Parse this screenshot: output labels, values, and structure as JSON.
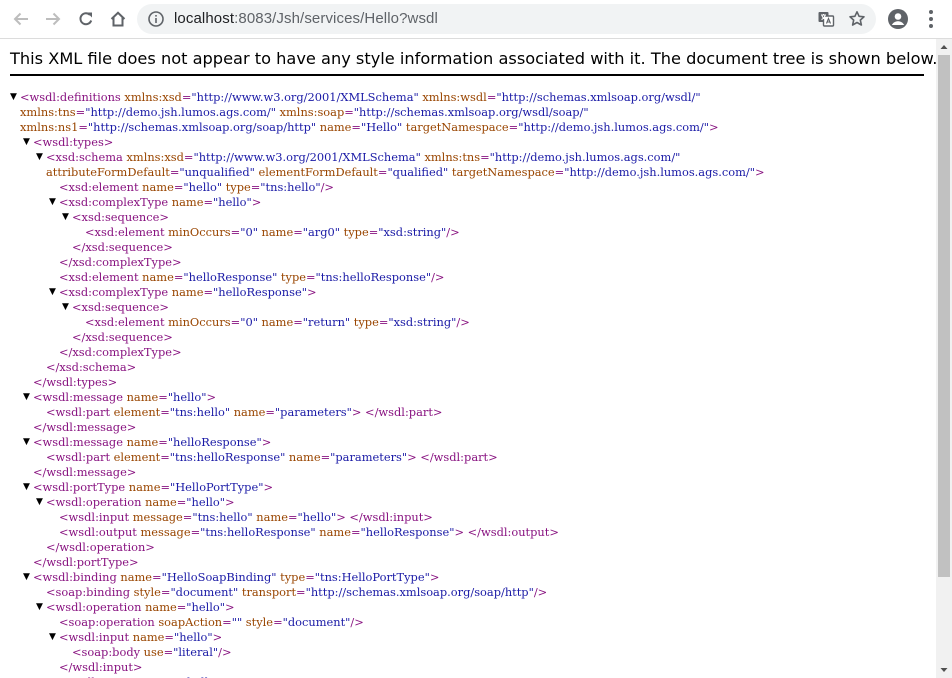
{
  "browser": {
    "url_host": "localhost",
    "url_rest": ":8083/Jsh/services/Hello?wsdl"
  },
  "page": {
    "info_message": "This XML file does not appear to have any style information associated with it. The document tree is shown below."
  },
  "colors": {
    "tag": "#881280",
    "attr_name": "#994500",
    "attr_value": "#1a1aa6"
  },
  "xml_lines": [
    {
      "indent": 0,
      "toggle": true,
      "parts": [
        [
          "t",
          "<wsdl:definitions"
        ],
        [
          "n",
          " xmlns:xsd"
        ],
        [
          "t",
          "="
        ],
        [
          "v",
          "\"http://www.w3.org/2001/XMLSchema\""
        ],
        [
          "n",
          " xmlns:wsdl"
        ],
        [
          "t",
          "="
        ],
        [
          "v",
          "\"http://schemas.xmlsoap.org/wsdl/\""
        ]
      ]
    },
    {
      "indent": 0,
      "toggle": false,
      "parts": [
        [
          "n",
          "xmlns:tns"
        ],
        [
          "t",
          "="
        ],
        [
          "v",
          "\"http://demo.jsh.lumos.ags.com/\""
        ],
        [
          "n",
          " xmlns:soap"
        ],
        [
          "t",
          "="
        ],
        [
          "v",
          "\"http://schemas.xmlsoap.org/wsdl/soap/\""
        ]
      ]
    },
    {
      "indent": 0,
      "toggle": false,
      "parts": [
        [
          "n",
          "xmlns:ns1"
        ],
        [
          "t",
          "="
        ],
        [
          "v",
          "\"http://schemas.xmlsoap.org/soap/http\""
        ],
        [
          "n",
          " name"
        ],
        [
          "t",
          "="
        ],
        [
          "v",
          "\"Hello\""
        ],
        [
          "n",
          " targetNamespace"
        ],
        [
          "t",
          "="
        ],
        [
          "v",
          "\"http://demo.jsh.lumos.ags.com/\""
        ],
        [
          "t",
          ">"
        ]
      ]
    },
    {
      "indent": 1,
      "toggle": true,
      "parts": [
        [
          "t",
          "<wsdl:types>"
        ]
      ]
    },
    {
      "indent": 2,
      "toggle": true,
      "parts": [
        [
          "t",
          "<xsd:schema"
        ],
        [
          "n",
          " xmlns:xsd"
        ],
        [
          "t",
          "="
        ],
        [
          "v",
          "\"http://www.w3.org/2001/XMLSchema\""
        ],
        [
          "n",
          " xmlns:tns"
        ],
        [
          "t",
          "="
        ],
        [
          "v",
          "\"http://demo.jsh.lumos.ags.com/\""
        ]
      ]
    },
    {
      "indent": 2,
      "toggle": false,
      "parts": [
        [
          "n",
          "attributeFormDefault"
        ],
        [
          "t",
          "="
        ],
        [
          "v",
          "\"unqualified\""
        ],
        [
          "n",
          " elementFormDefault"
        ],
        [
          "t",
          "="
        ],
        [
          "v",
          "\"qualified\""
        ],
        [
          "n",
          " targetNamespace"
        ],
        [
          "t",
          "="
        ],
        [
          "v",
          "\"http://demo.jsh.lumos.ags.com/\""
        ],
        [
          "t",
          ">"
        ]
      ]
    },
    {
      "indent": 3,
      "toggle": false,
      "parts": [
        [
          "t",
          "<xsd:element"
        ],
        [
          "n",
          " name"
        ],
        [
          "t",
          "="
        ],
        [
          "v",
          "\"hello\""
        ],
        [
          "n",
          " type"
        ],
        [
          "t",
          "="
        ],
        [
          "v",
          "\"tns:hello\""
        ],
        [
          "t",
          "/>"
        ]
      ]
    },
    {
      "indent": 3,
      "toggle": true,
      "parts": [
        [
          "t",
          "<xsd:complexType"
        ],
        [
          "n",
          " name"
        ],
        [
          "t",
          "="
        ],
        [
          "v",
          "\"hello\""
        ],
        [
          "t",
          ">"
        ]
      ]
    },
    {
      "indent": 4,
      "toggle": true,
      "parts": [
        [
          "t",
          "<xsd:sequence>"
        ]
      ]
    },
    {
      "indent": 5,
      "toggle": false,
      "parts": [
        [
          "t",
          "<xsd:element"
        ],
        [
          "n",
          " minOccurs"
        ],
        [
          "t",
          "="
        ],
        [
          "v",
          "\"0\""
        ],
        [
          "n",
          " name"
        ],
        [
          "t",
          "="
        ],
        [
          "v",
          "\"arg0\""
        ],
        [
          "n",
          " type"
        ],
        [
          "t",
          "="
        ],
        [
          "v",
          "\"xsd:string\""
        ],
        [
          "t",
          "/>"
        ]
      ]
    },
    {
      "indent": 4,
      "toggle": false,
      "parts": [
        [
          "t",
          "</xsd:sequence>"
        ]
      ]
    },
    {
      "indent": 3,
      "toggle": false,
      "parts": [
        [
          "t",
          "</xsd:complexType>"
        ]
      ]
    },
    {
      "indent": 3,
      "toggle": false,
      "parts": [
        [
          "t",
          "<xsd:element"
        ],
        [
          "n",
          " name"
        ],
        [
          "t",
          "="
        ],
        [
          "v",
          "\"helloResponse\""
        ],
        [
          "n",
          " type"
        ],
        [
          "t",
          "="
        ],
        [
          "v",
          "\"tns:helloResponse\""
        ],
        [
          "t",
          "/>"
        ]
      ]
    },
    {
      "indent": 3,
      "toggle": true,
      "parts": [
        [
          "t",
          "<xsd:complexType"
        ],
        [
          "n",
          " name"
        ],
        [
          "t",
          "="
        ],
        [
          "v",
          "\"helloResponse\""
        ],
        [
          "t",
          ">"
        ]
      ]
    },
    {
      "indent": 4,
      "toggle": true,
      "parts": [
        [
          "t",
          "<xsd:sequence>"
        ]
      ]
    },
    {
      "indent": 5,
      "toggle": false,
      "parts": [
        [
          "t",
          "<xsd:element"
        ],
        [
          "n",
          " minOccurs"
        ],
        [
          "t",
          "="
        ],
        [
          "v",
          "\"0\""
        ],
        [
          "n",
          " name"
        ],
        [
          "t",
          "="
        ],
        [
          "v",
          "\"return\""
        ],
        [
          "n",
          " type"
        ],
        [
          "t",
          "="
        ],
        [
          "v",
          "\"xsd:string\""
        ],
        [
          "t",
          "/>"
        ]
      ]
    },
    {
      "indent": 4,
      "toggle": false,
      "parts": [
        [
          "t",
          "</xsd:sequence>"
        ]
      ]
    },
    {
      "indent": 3,
      "toggle": false,
      "parts": [
        [
          "t",
          "</xsd:complexType>"
        ]
      ]
    },
    {
      "indent": 2,
      "toggle": false,
      "parts": [
        [
          "t",
          "</xsd:schema>"
        ]
      ]
    },
    {
      "indent": 1,
      "toggle": false,
      "parts": [
        [
          "t",
          "</wsdl:types>"
        ]
      ]
    },
    {
      "indent": 1,
      "toggle": true,
      "parts": [
        [
          "t",
          "<wsdl:message"
        ],
        [
          "n",
          " name"
        ],
        [
          "t",
          "="
        ],
        [
          "v",
          "\"hello\""
        ],
        [
          "t",
          ">"
        ]
      ]
    },
    {
      "indent": 2,
      "toggle": false,
      "parts": [
        [
          "t",
          "<wsdl:part"
        ],
        [
          "n",
          " element"
        ],
        [
          "t",
          "="
        ],
        [
          "v",
          "\"tns:hello\""
        ],
        [
          "n",
          " name"
        ],
        [
          "t",
          "="
        ],
        [
          "v",
          "\"parameters\""
        ],
        [
          "t",
          "> </wsdl:part>"
        ]
      ]
    },
    {
      "indent": 1,
      "toggle": false,
      "parts": [
        [
          "t",
          "</wsdl:message>"
        ]
      ]
    },
    {
      "indent": 1,
      "toggle": true,
      "parts": [
        [
          "t",
          "<wsdl:message"
        ],
        [
          "n",
          " name"
        ],
        [
          "t",
          "="
        ],
        [
          "v",
          "\"helloResponse\""
        ],
        [
          "t",
          ">"
        ]
      ]
    },
    {
      "indent": 2,
      "toggle": false,
      "parts": [
        [
          "t",
          "<wsdl:part"
        ],
        [
          "n",
          " element"
        ],
        [
          "t",
          "="
        ],
        [
          "v",
          "\"tns:helloResponse\""
        ],
        [
          "n",
          " name"
        ],
        [
          "t",
          "="
        ],
        [
          "v",
          "\"parameters\""
        ],
        [
          "t",
          "> </wsdl:part>"
        ]
      ]
    },
    {
      "indent": 1,
      "toggle": false,
      "parts": [
        [
          "t",
          "</wsdl:message>"
        ]
      ]
    },
    {
      "indent": 1,
      "toggle": true,
      "parts": [
        [
          "t",
          "<wsdl:portType"
        ],
        [
          "n",
          " name"
        ],
        [
          "t",
          "="
        ],
        [
          "v",
          "\"HelloPortType\""
        ],
        [
          "t",
          ">"
        ]
      ]
    },
    {
      "indent": 2,
      "toggle": true,
      "parts": [
        [
          "t",
          "<wsdl:operation"
        ],
        [
          "n",
          " name"
        ],
        [
          "t",
          "="
        ],
        [
          "v",
          "\"hello\""
        ],
        [
          "t",
          ">"
        ]
      ]
    },
    {
      "indent": 3,
      "toggle": false,
      "parts": [
        [
          "t",
          "<wsdl:input"
        ],
        [
          "n",
          " message"
        ],
        [
          "t",
          "="
        ],
        [
          "v",
          "\"tns:hello\""
        ],
        [
          "n",
          " name"
        ],
        [
          "t",
          "="
        ],
        [
          "v",
          "\"hello\""
        ],
        [
          "t",
          "> </wsdl:input>"
        ]
      ]
    },
    {
      "indent": 3,
      "toggle": false,
      "parts": [
        [
          "t",
          "<wsdl:output"
        ],
        [
          "n",
          " message"
        ],
        [
          "t",
          "="
        ],
        [
          "v",
          "\"tns:helloResponse\""
        ],
        [
          "n",
          " name"
        ],
        [
          "t",
          "="
        ],
        [
          "v",
          "\"helloResponse\""
        ],
        [
          "t",
          "> </wsdl:output>"
        ]
      ]
    },
    {
      "indent": 2,
      "toggle": false,
      "parts": [
        [
          "t",
          "</wsdl:operation>"
        ]
      ]
    },
    {
      "indent": 1,
      "toggle": false,
      "parts": [
        [
          "t",
          "</wsdl:portType>"
        ]
      ]
    },
    {
      "indent": 1,
      "toggle": true,
      "parts": [
        [
          "t",
          "<wsdl:binding"
        ],
        [
          "n",
          " name"
        ],
        [
          "t",
          "="
        ],
        [
          "v",
          "\"HelloSoapBinding\""
        ],
        [
          "n",
          " type"
        ],
        [
          "t",
          "="
        ],
        [
          "v",
          "\"tns:HelloPortType\""
        ],
        [
          "t",
          ">"
        ]
      ]
    },
    {
      "indent": 2,
      "toggle": false,
      "parts": [
        [
          "t",
          "<soap:binding"
        ],
        [
          "n",
          " style"
        ],
        [
          "t",
          "="
        ],
        [
          "v",
          "\"document\""
        ],
        [
          "n",
          " transport"
        ],
        [
          "t",
          "="
        ],
        [
          "v",
          "\"http://schemas.xmlsoap.org/soap/http\""
        ],
        [
          "t",
          "/>"
        ]
      ]
    },
    {
      "indent": 2,
      "toggle": true,
      "parts": [
        [
          "t",
          "<wsdl:operation"
        ],
        [
          "n",
          " name"
        ],
        [
          "t",
          "="
        ],
        [
          "v",
          "\"hello\""
        ],
        [
          "t",
          ">"
        ]
      ]
    },
    {
      "indent": 3,
      "toggle": false,
      "parts": [
        [
          "t",
          "<soap:operation"
        ],
        [
          "n",
          " soapAction"
        ],
        [
          "t",
          "="
        ],
        [
          "v",
          "\"\""
        ],
        [
          "n",
          " style"
        ],
        [
          "t",
          "="
        ],
        [
          "v",
          "\"document\""
        ],
        [
          "t",
          "/>"
        ]
      ]
    },
    {
      "indent": 3,
      "toggle": true,
      "parts": [
        [
          "t",
          "<wsdl:input"
        ],
        [
          "n",
          " name"
        ],
        [
          "t",
          "="
        ],
        [
          "v",
          "\"hello\""
        ],
        [
          "t",
          ">"
        ]
      ]
    },
    {
      "indent": 4,
      "toggle": false,
      "parts": [
        [
          "t",
          "<soap:body"
        ],
        [
          "n",
          " use"
        ],
        [
          "t",
          "="
        ],
        [
          "v",
          "\"literal\""
        ],
        [
          "t",
          "/>"
        ]
      ]
    },
    {
      "indent": 3,
      "toggle": false,
      "parts": [
        [
          "t",
          "</wsdl:input>"
        ]
      ]
    },
    {
      "indent": 3,
      "toggle": true,
      "parts": [
        [
          "t",
          "<wsdl:output"
        ],
        [
          "n",
          " name"
        ],
        [
          "t",
          "="
        ],
        [
          "v",
          "\"helloResponse\""
        ],
        [
          "t",
          ">"
        ]
      ]
    }
  ]
}
